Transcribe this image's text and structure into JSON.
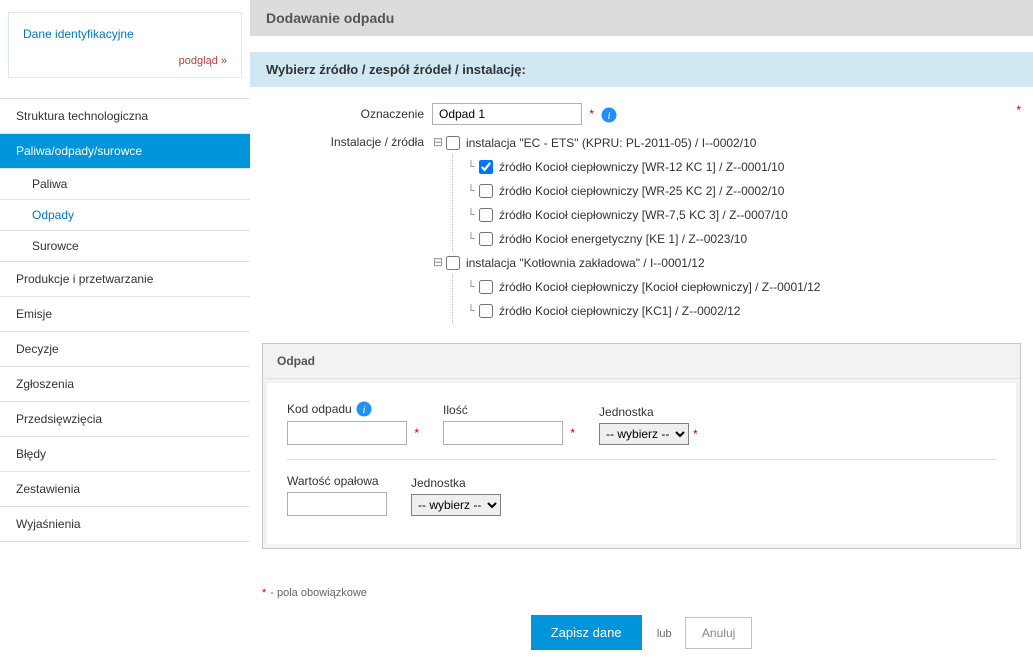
{
  "identBox": {
    "link": "Dane identyfikacyjne",
    "preview": "podgląd »"
  },
  "sidebar": {
    "items": [
      {
        "label": "Struktura technologiczna",
        "hasSub": false
      },
      {
        "label": "Paliwa/odpady/surowce",
        "hasSub": true,
        "active": true,
        "sub": [
          {
            "label": "Paliwa"
          },
          {
            "label": "Odpady",
            "selected": true
          },
          {
            "label": "Surowce"
          }
        ]
      },
      {
        "label": "Produkcje i przetwarzanie"
      },
      {
        "label": "Emisje"
      },
      {
        "label": "Decyzje"
      },
      {
        "label": "Zgłoszenia"
      },
      {
        "label": "Przedsięwzięcia"
      },
      {
        "label": "Błędy"
      },
      {
        "label": "Zestawienia"
      },
      {
        "label": "Wyjaśnienia"
      }
    ]
  },
  "page": {
    "title": "Dodawanie odpadu",
    "sectionTitle": "Wybierz źródło / zespół źródeł / instalację:",
    "oznaczenieLabel": "Oznaczenie",
    "oznaczenieValue": "Odpad 1",
    "instalacjeLabel": "Instalacje / źródła"
  },
  "tree": [
    {
      "label": "instalacja \"EC - ETS\" (KPRU: PL-2011-05) / I--0002/10",
      "expanded": true,
      "checked": false,
      "children": [
        {
          "label": "źródło Kocioł ciepłowniczy [WR-12 KC 1] / Z--0001/10",
          "checked": true
        },
        {
          "label": "źródło Kocioł ciepłowniczy [WR-25 KC 2] / Z--0002/10",
          "checked": false
        },
        {
          "label": "źródło Kocioł ciepłowniczy [WR-7,5 KC 3] / Z--0007/10",
          "checked": false
        },
        {
          "label": "źródło Kocioł energetyczny [KE 1] / Z--0023/10",
          "checked": false
        }
      ]
    },
    {
      "label": "instalacja \"Kotłownia zakładowa\" / I--0001/12",
      "expanded": true,
      "checked": false,
      "children": [
        {
          "label": "źródło Kocioł ciepłowniczy [Kocioł ciepłowniczy] / Z--0001/12",
          "checked": false
        },
        {
          "label": "źródło Kocioł ciepłowniczy [KC1] / Z--0002/12",
          "checked": false
        }
      ]
    }
  ],
  "panel": {
    "header": "Odpad",
    "kodLabel": "Kod odpadu",
    "iloscLabel": "Ilość",
    "jednostkaLabel": "Jednostka",
    "jednostkaPlaceholder": "-- wybierz --",
    "wartoscLabel": "Wartość opałowa",
    "jednostka2Label": "Jednostka",
    "jednostka2Placeholder": "-- wybierz --"
  },
  "footnote": "- pola obowiązkowe",
  "actions": {
    "save": "Zapisz dane",
    "or": "lub",
    "cancel": "Anuluj"
  },
  "asterisk": "*"
}
